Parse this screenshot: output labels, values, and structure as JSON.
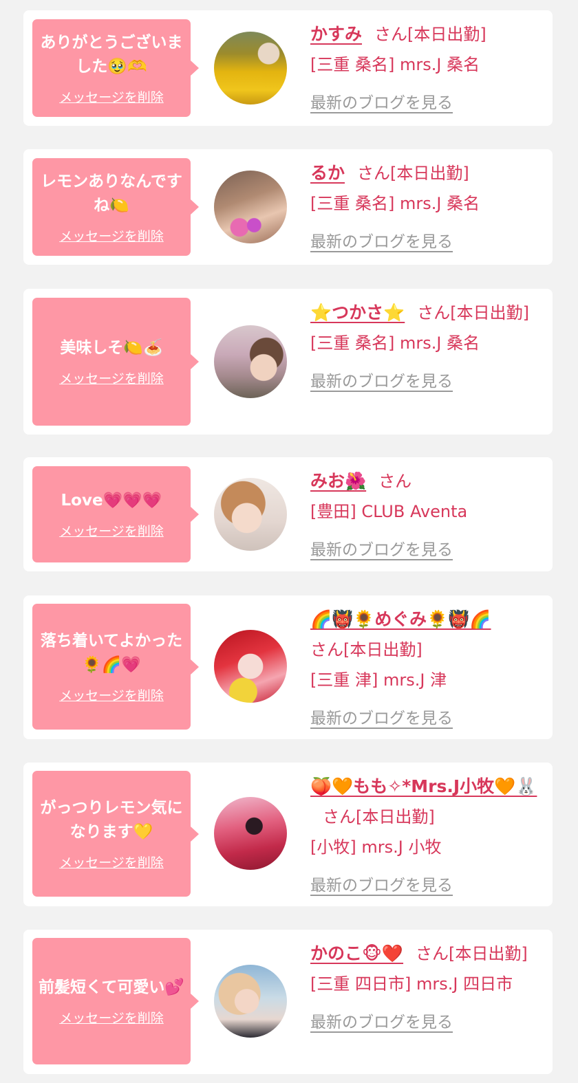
{
  "favorites": [
    {
      "message": "ありがとうございました🥹🫶",
      "delete_label": "メッセージを削除",
      "name": "かすみ",
      "suffix": "さん[本日出勤]",
      "shop": "[三重 桑名] mrs.J 桑名",
      "blog_label": "最新のブログを見る",
      "avatar": "photo-yellow-flowers"
    },
    {
      "message": "レモンありなんですね🍋",
      "delete_label": "メッセージを削除",
      "name": "るか",
      "suffix": "さん[本日出勤]",
      "shop": "[三重 桑名] mrs.J 桑名",
      "blog_label": "最新のブログを見る",
      "avatar": "photo-tulips"
    },
    {
      "message": "美味しそ🍋🍝",
      "delete_label": "メッセージを削除",
      "name": "⭐️つかさ⭐️",
      "suffix": "さん[本日出勤]",
      "shop": "[三重 桑名] mrs.J 桑名",
      "blog_label": "最新のブログを見る",
      "avatar": "photo-cherry-blossom"
    },
    {
      "message": "Love💗💗💗",
      "delete_label": "メッセージを削除",
      "name": "みお🌺",
      "suffix": "さん",
      "shop": "[豊田] CLUB Aventa",
      "blog_label": "最新のブログを見る",
      "avatar": "photo-pale"
    },
    {
      "message": "落ち着いてよかった🌻🌈💗",
      "delete_label": "メッセージを削除",
      "name": "🌈👹🌻めぐみ🌻👹🌈",
      "suffix": "さん[本日出勤]",
      "shop": "[三重 津] mrs.J 津",
      "blog_label": "最新のブログを見る",
      "avatar": "photo-red"
    },
    {
      "message": "がっつりレモン気になります💛",
      "delete_label": "メッセージを削除",
      "name": "🍑🧡もも✧*Mrs.J小牧🧡🐰",
      "suffix": "さん[本日出勤]",
      "shop": "[小牧] mrs.J 小牧",
      "blog_label": "最新のブログを見る",
      "avatar": "photo-pink-stage"
    },
    {
      "message": "前髪短くて可愛い💕",
      "delete_label": "メッセージを削除",
      "name": "かのこ🐵❤️",
      "suffix": "さん[本日出勤]",
      "shop": "[三重 四日市] mrs.J 四日市",
      "blog_label": "最新のブログを見る",
      "avatar": "photo-blue"
    }
  ]
}
